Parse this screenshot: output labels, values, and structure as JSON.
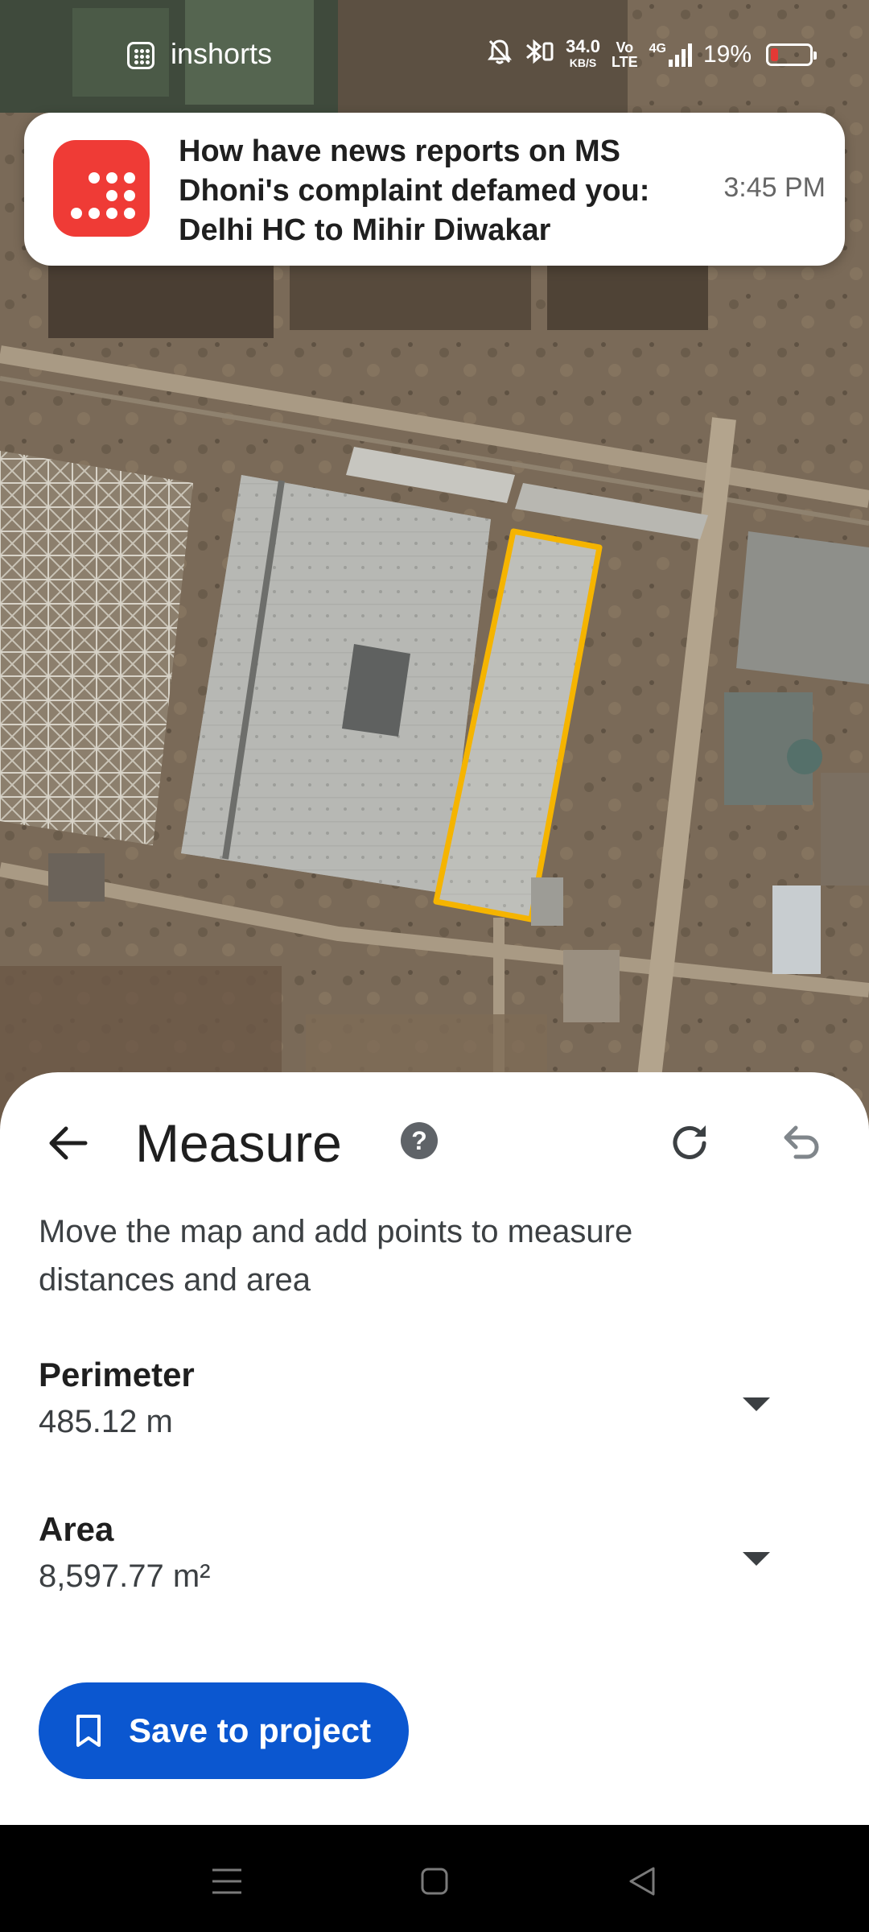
{
  "status_bar": {
    "app_name": "inshorts",
    "net_speed_value": "34.0",
    "net_speed_unit": "KB/S",
    "volte": "Vo\nLTE",
    "network": "4G",
    "battery_percent": "19%",
    "battery_level": 0.19,
    "icons": [
      "inshorts-app-icon",
      "mute-bell-icon",
      "bluetooth-icon",
      "signal-icon",
      "battery-icon"
    ]
  },
  "notification": {
    "app_icon": "inshorts-logo-icon",
    "text": "How have news reports on MS Dhoni's complaint defamed you: Delhi HC to Mihir Diwakar",
    "time": "3:45 PM",
    "accent_color": "#ef3b36"
  },
  "measure": {
    "title": "Measure",
    "help_label": "?",
    "instructions": "Move the map and add points to measure distances and area",
    "perimeter_label": "Perimeter",
    "perimeter_value": "485.12 m",
    "area_label": "Area",
    "area_value": "8,597.77 m²",
    "save_label": "Save to project",
    "accent_color": "#0b57d0",
    "outline_color": "#f5b400",
    "icons": [
      "back-arrow-icon",
      "help-icon",
      "redo-icon",
      "undo-icon",
      "chevron-down-icon",
      "bookmark-icon"
    ]
  },
  "nav_bar": {
    "icons": [
      "menu-icon",
      "home-icon",
      "back-icon"
    ]
  }
}
